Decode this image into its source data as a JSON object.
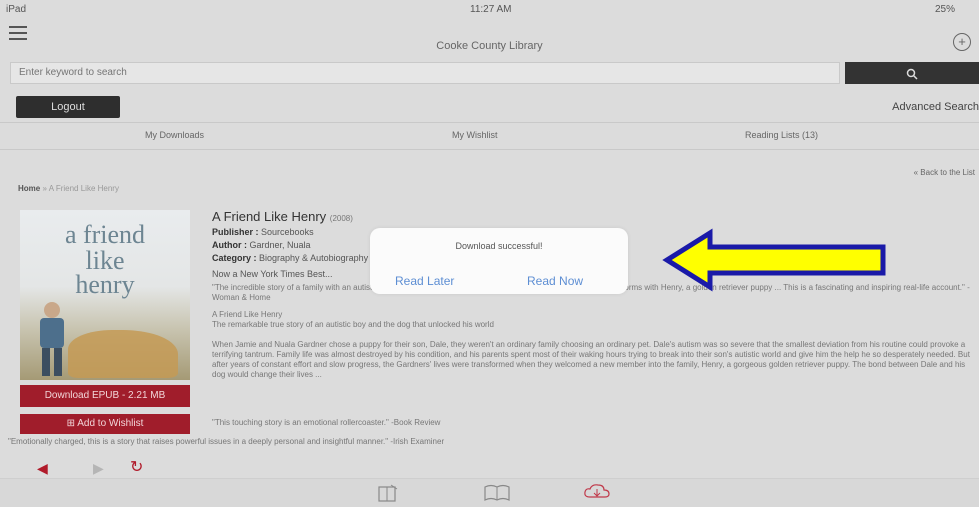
{
  "status": {
    "carrier": "iPad",
    "time": "11:27 AM",
    "battery": "25%"
  },
  "header": {
    "title": "Cooke County Library",
    "plus_icon": "plus-circle-icon"
  },
  "search": {
    "placeholder": "Enter keyword to search"
  },
  "account": {
    "logout": "Logout",
    "advanced": "Advanced Search"
  },
  "subnav": [
    "My Downloads",
    "My Wishlist",
    "Reading Lists (13)"
  ],
  "back_link": "« Back to the List",
  "breadcrumb": {
    "home": "Home",
    "current": "» A Friend Like Henry"
  },
  "cover": {
    "line1": "a friend",
    "line2": "like",
    "line3": "henry"
  },
  "book": {
    "title": "A Friend Like Henry",
    "format": "(2008)",
    "publisher_label": "Publisher :",
    "publisher": "Sourcebooks",
    "author_label": "Author :",
    "author": "Gardner, Nuala",
    "category_label": "Category :",
    "category": "Biography & Autobiography",
    "bestseller": "Now a New York Times Best...",
    "quote1": "\"The incredible story of a family with an autistic son, Dale, who conquers his disability thanks to the special bond he forms with Henry, a golden retriever puppy ... This is a fascinating and inspiring real-life account.\" -Woman & Home",
    "subtitle": "A Friend Like Henry",
    "subtitle2": "The remarkable true story of an autistic boy and the dog that unlocked his world",
    "description": "When Jamie and Nuala Gardner chose a puppy for their son, Dale, they weren't an ordinary family choosing an ordinary pet. Dale's autism was so severe that the smallest deviation from his routine could provoke a terrifying tantrum. Family life was almost destroyed by his condition, and his parents spent most of their waking hours trying to break into their son's autistic world and give him the help he so desperately needed. But after years of constant effort and slow progress, the Gardners' lives were transformed when they welcomed a new member into the family, Henry, a gorgeous golden retriever puppy. The bond between Dale and his dog would change their lives ...",
    "review1": "\"This touching story is an emotional rollercoaster.\" -Book Review",
    "review2": "\"Emotionally charged, this is a story that raises powerful issues in a deeply personal and insightful manner.\" -Irish Examiner"
  },
  "actions": {
    "download": "Download EPUB - 2.21 MB",
    "wishlist": "Add to Wishlist"
  },
  "alert": {
    "message": "Download successful!",
    "read_later": "Read Later",
    "read_now": "Read Now"
  },
  "colors": {
    "accent": "#a01d2b",
    "arrow": "#ffff00",
    "arrow_outline": "#1a1aa8",
    "alert_link": "#5d8ed3"
  }
}
